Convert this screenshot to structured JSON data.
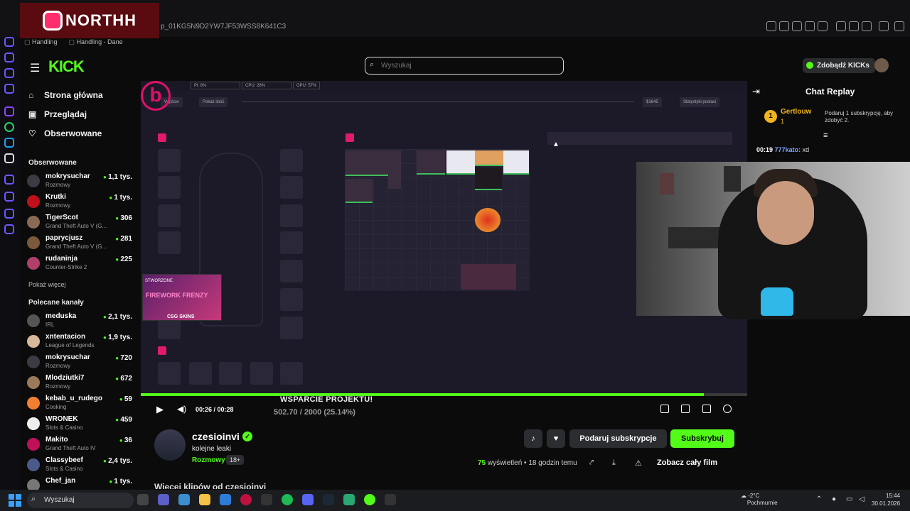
{
  "browser": {
    "url": "p_01KG5N9D2YW7JF53WSS8K641C3",
    "bookmarks": [
      "Handling",
      "Handling - Dane"
    ],
    "overlay_brand": "NORTHH"
  },
  "header": {
    "logo": "KICK",
    "search_placeholder": "Wyszukaj",
    "get_kicks": "Zdobądź KICKs"
  },
  "sidebar": {
    "nav": [
      "Strona główna",
      "Przeglądaj",
      "Obserwowane"
    ],
    "followed_title": "Obserwowane",
    "followed": [
      {
        "name": "mokrysuchar",
        "category": "Rozmowy",
        "viewers": "1,1 tys."
      },
      {
        "name": "Krutki",
        "category": "Rozmowy",
        "viewers": "1 tys."
      },
      {
        "name": "TigerScot",
        "category": "Grand Theft Auto V (G...",
        "viewers": "306"
      },
      {
        "name": "paprycjusz",
        "category": "Grand Theft Auto V (G...",
        "viewers": "281"
      },
      {
        "name": "rudaninja",
        "category": "Counter-Strike 2",
        "viewers": "225"
      }
    ],
    "show_more": "Pokaż więcej",
    "recommended_title": "Polecane kanały",
    "recommended": [
      {
        "name": "meduska",
        "category": "IRL",
        "viewers": "2,1 tys."
      },
      {
        "name": "xntentacion",
        "category": "League of Legends",
        "viewers": "1,9 tys."
      },
      {
        "name": "mokrysuchar",
        "category": "Rozmowy",
        "viewers": "720"
      },
      {
        "name": "Mlodziutki7",
        "category": "Rozmowy",
        "viewers": "672"
      },
      {
        "name": "kebab_u_rudego",
        "category": "Cooking",
        "viewers": "59"
      },
      {
        "name": "WRONEK",
        "category": "Slots & Casino",
        "viewers": "459"
      },
      {
        "name": "Makito",
        "category": "Grand Theft Auto IV",
        "viewers": "36"
      },
      {
        "name": "Classybeef",
        "category": "Slots & Casino",
        "viewers": "2,4 tys."
      },
      {
        "name": "Chef_jan",
        "category": "",
        "viewers": "1 tys."
      }
    ]
  },
  "game": {
    "stats": [
      "Pl: 8%",
      "CPU: 26%",
      "GPU: 57%"
    ],
    "buttons": [
      "Wyjście",
      "Pokaż ilość",
      "$1645",
      "Statystyki postaci"
    ],
    "promo_top": "STWORZONE",
    "promo_title": "FIREWORK FRENZY",
    "promo_brand": "CSG SKINS"
  },
  "player": {
    "time": "00:26 / 00:28",
    "support_title": "WSPARCIE PROJEKTU!",
    "support_value": "502.70 / 2000 (25.14%)",
    "progress": 0.9286
  },
  "channel": {
    "name": "czesioinvi",
    "title": "kolejne leaki",
    "category": "Rozmowy",
    "age": "18+",
    "gift_sub": "Podaruj subskrypcje",
    "subscribe": "Subskrybuj",
    "views_count": "75",
    "views_text": "wyświetleń • 18 godzin temu",
    "full_film": "Zobacz cały film",
    "more_clips": "Więcej klipów od czesioinvi"
  },
  "chat": {
    "title": "Chat Replay",
    "gifter_name": "Gertlouw",
    "gifter_count": "1",
    "gift_hint": "Podaruj 1 subskrypcję, aby zdobyć 2.",
    "message_time": "00:19",
    "message_user": "777kato:",
    "message_text": "xd"
  },
  "taskbar": {
    "search": "Wyszukaj",
    "temp": "-2°C",
    "weather": "Pochmurnie",
    "time": "15:44",
    "date": "30.01.2026"
  },
  "colors": {
    "accent": "#53fc18",
    "game_pink": "#e01b6a",
    "background": "#0b0b0c"
  }
}
